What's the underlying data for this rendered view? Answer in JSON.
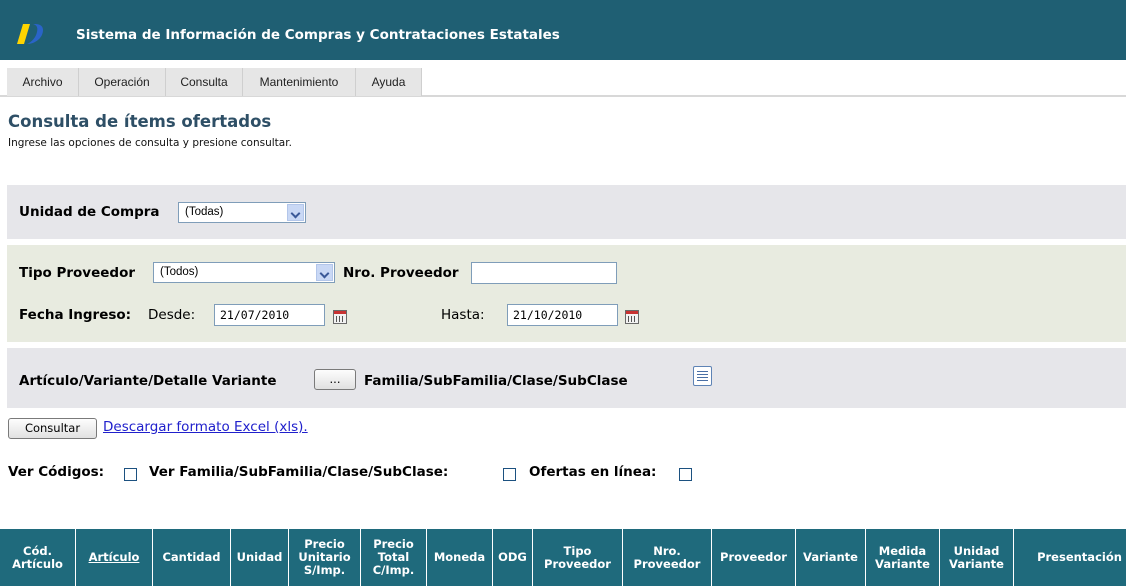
{
  "header": {
    "title": "Sistema de Información de Compras y Contrataciones Estatales",
    "logo_colors": [
      "#ffd400",
      "#2a64c8"
    ]
  },
  "menu": {
    "items": [
      "Archivo",
      "Operación",
      "Consulta",
      "Mantenimiento",
      "Ayuda"
    ]
  },
  "page": {
    "title": "Consulta de ítems ofertados",
    "subtitle": "Ingrese las opciones de consulta y presione consultar."
  },
  "form": {
    "unidad_compra_label": "Unidad de Compra",
    "unidad_compra_value": "(Todas)",
    "tipo_proveedor_label": "Tipo Proveedor",
    "tipo_proveedor_value": "(Todos)",
    "nro_proveedor_label": "Nro. Proveedor",
    "nro_proveedor_value": "",
    "fecha_ingreso_label": "Fecha Ingreso:",
    "desde_label": "Desde:",
    "desde_value": "21/07/2010",
    "hasta_label": "Hasta:",
    "hasta_value": "21/10/2010",
    "articulo_label": "Artículo/Variante/Detalle Variante",
    "articulo_button": "...",
    "familia_label": "Familia/SubFamilia/Clase/SubClase"
  },
  "actions": {
    "consultar": "Consultar",
    "excel_link": "Descargar formato Excel (xls)."
  },
  "options": {
    "ver_codigos": "Ver Códigos:",
    "ver_familia": "Ver Familia/SubFamilia/Clase/SubClase:",
    "ofertas_linea": "Ofertas en línea:",
    "ver_codigos_checked": false,
    "ver_familia_checked": false,
    "ofertas_linea_checked": false
  },
  "table": {
    "columns": [
      {
        "label": "Cód.\nArtículo",
        "sortable": false
      },
      {
        "label": "Artículo",
        "sortable": true
      },
      {
        "label": "Cantidad",
        "sortable": false
      },
      {
        "label": "Unidad",
        "sortable": false
      },
      {
        "label": "Precio\nUnitario\nS/Imp.",
        "sortable": false
      },
      {
        "label": "Precio\nTotal\nC/Imp.",
        "sortable": false
      },
      {
        "label": "Moneda",
        "sortable": false
      },
      {
        "label": "ODG",
        "sortable": false
      },
      {
        "label": "Tipo\nProveedor",
        "sortable": false
      },
      {
        "label": "Nro.\nProveedor",
        "sortable": false
      },
      {
        "label": "Proveedor",
        "sortable": false
      },
      {
        "label": "Variante",
        "sortable": false
      },
      {
        "label": "Medida\nVariante",
        "sortable": false
      },
      {
        "label": "Unidad\nVariante",
        "sortable": false
      },
      {
        "label": "Presentación",
        "sortable": false
      }
    ]
  }
}
